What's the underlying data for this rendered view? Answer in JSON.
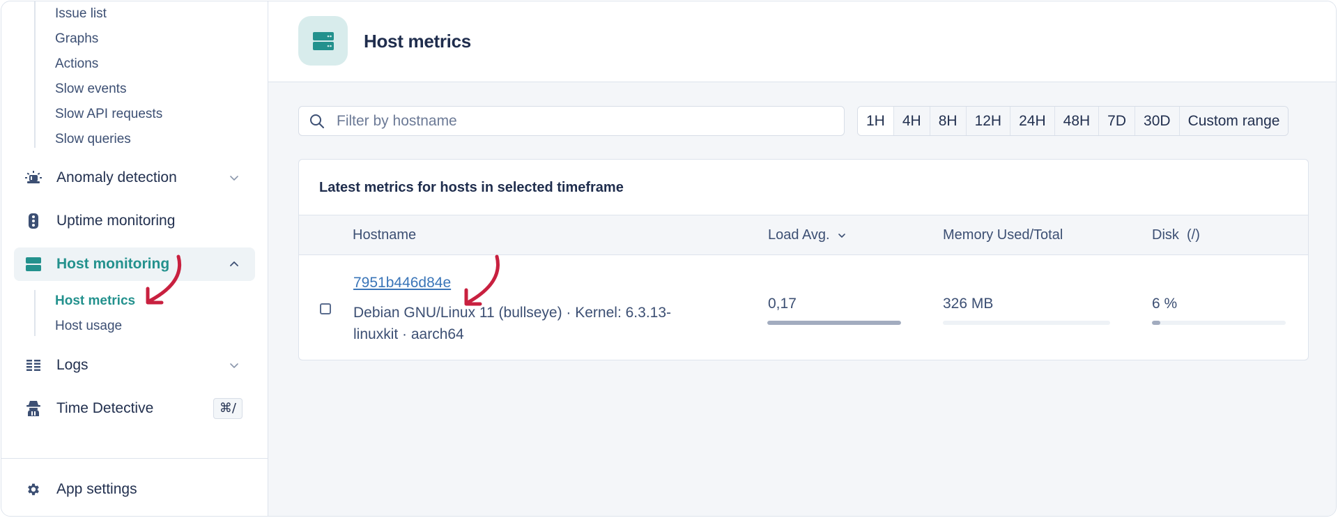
{
  "sidebar": {
    "sub_items_top": [
      {
        "label": "Issue list"
      },
      {
        "label": "Graphs"
      },
      {
        "label": "Actions"
      },
      {
        "label": "Slow events"
      },
      {
        "label": "Slow API requests"
      },
      {
        "label": "Slow queries"
      }
    ],
    "nav": {
      "anomaly": {
        "label": "Anomaly detection",
        "icon": "siren-icon",
        "chevron": "chevron-down-icon"
      },
      "uptime": {
        "label": "Uptime monitoring",
        "icon": "traffic-light-icon"
      },
      "host": {
        "label": "Host monitoring",
        "icon": "server-icon",
        "chevron": "chevron-up-icon",
        "active": true
      },
      "logs": {
        "label": "Logs",
        "icon": "list-icon",
        "chevron": "chevron-down-icon"
      },
      "time_detective": {
        "label": "Time Detective",
        "icon": "detective-icon",
        "shortcut": "⌘/"
      },
      "app_settings": {
        "label": "App settings",
        "icon": "gear-icon"
      }
    },
    "host_sub_items": [
      {
        "label": "Host metrics",
        "active": true
      },
      {
        "label": "Host usage"
      }
    ]
  },
  "header": {
    "title": "Host metrics",
    "icon": "server-icon"
  },
  "filter": {
    "placeholder": "Filter by hostname",
    "value": ""
  },
  "time_ranges": {
    "options": [
      "1H",
      "4H",
      "8H",
      "12H",
      "24H",
      "48H",
      "7D",
      "30D",
      "Custom range"
    ],
    "selected": "1H"
  },
  "table": {
    "title": "Latest metrics for hosts in selected timeframe",
    "columns": {
      "hostname": "Hostname",
      "load": "Load Avg.",
      "memory": "Memory Used/Total",
      "disk": "Disk  (/)"
    },
    "sort_column": "load",
    "rows": [
      {
        "hostname": "7951b446d84e",
        "description": "Debian GNU/Linux 11 (bullseye) · Kernel: 6.3.13-linuxkit · aarch64",
        "load": "0,17",
        "load_fraction": 1.0,
        "memory": "326 MB",
        "memory_fraction": 0.0,
        "disk": "6 %",
        "disk_fraction": 0.06
      }
    ]
  },
  "colors": {
    "accent": "#23918d",
    "annotation_arrow": "#c8203f",
    "link": "#3a75b8",
    "text": "#1f2d4d"
  }
}
